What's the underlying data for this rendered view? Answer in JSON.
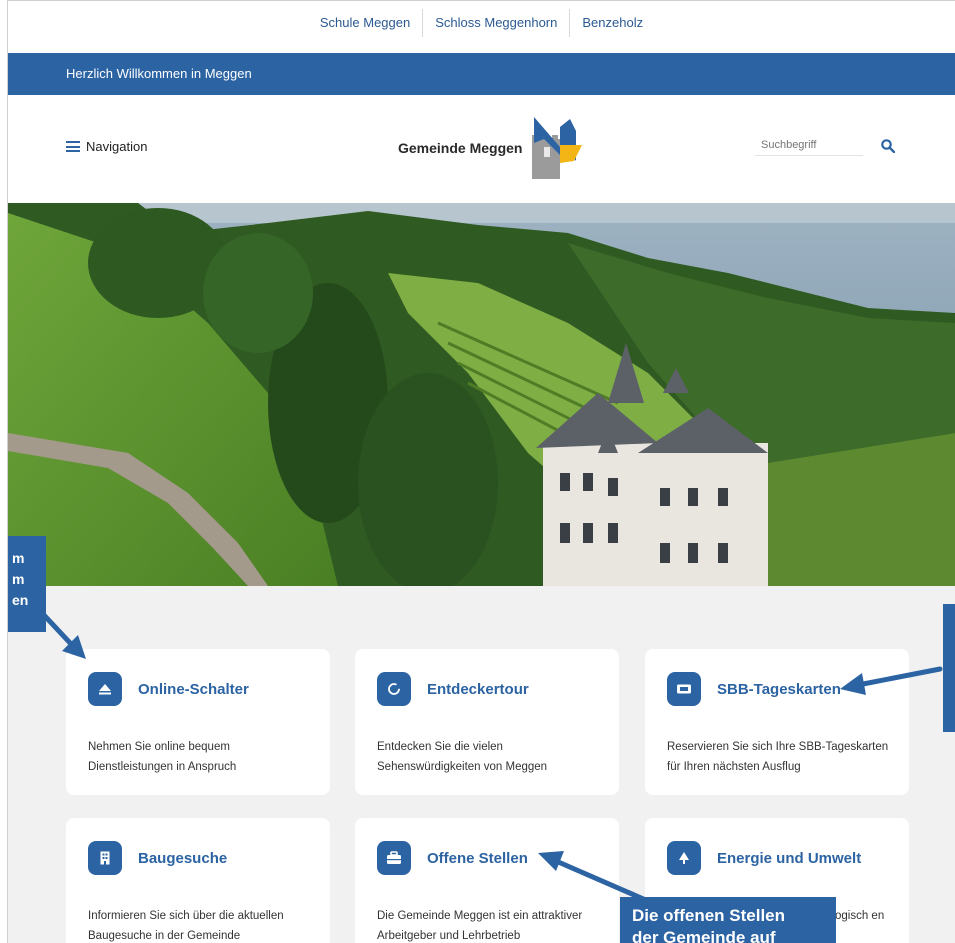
{
  "toplinks": [
    "Schule Meggen",
    "Schloss Meggenhorn",
    "Benzeholz"
  ],
  "welcome": "Herzlich Willkommen in Meggen",
  "header": {
    "nav_label": "Navigation",
    "logo_text": "Gemeinde Meggen",
    "search_placeholder": "Suchbegriff"
  },
  "cards": [
    {
      "title": "Online-Schalter",
      "icon": "eject-icon",
      "desc": "Nehmen Sie online bequem Dienstleistungen in Anspruch"
    },
    {
      "title": "Entdeckertour",
      "icon": "circle-icon",
      "desc": "Entdecken Sie die vielen Sehenswürdigkeiten von Meggen"
    },
    {
      "title": "SBB-Tageskarten",
      "icon": "ticket-icon",
      "desc": "Reservieren Sie sich Ihre SBB-Tageskarten für Ihren nächsten Ausflug"
    },
    {
      "title": "Baugesuche",
      "icon": "building-icon",
      "desc": "Informieren Sie sich über die aktuellen Baugesuche in der Gemeinde"
    },
    {
      "title": "Offene Stellen",
      "icon": "briefcase-icon",
      "desc": "Die Gemeinde Meggen ist ein attraktiver Arbeitgeber und Lehrbetrieb"
    },
    {
      "title": "Energie und Umwelt",
      "icon": "tree-icon",
      "desc": "ogisch en"
    }
  ],
  "annotations": {
    "left_lines": [
      "m",
      "m",
      "en"
    ],
    "bottom_line": "Die offenen Stellen",
    "bottom_line2": "der Gemeinde auf"
  },
  "colors": {
    "brand_blue": "#2c63a3",
    "page_bg": "#f1f1f1"
  }
}
